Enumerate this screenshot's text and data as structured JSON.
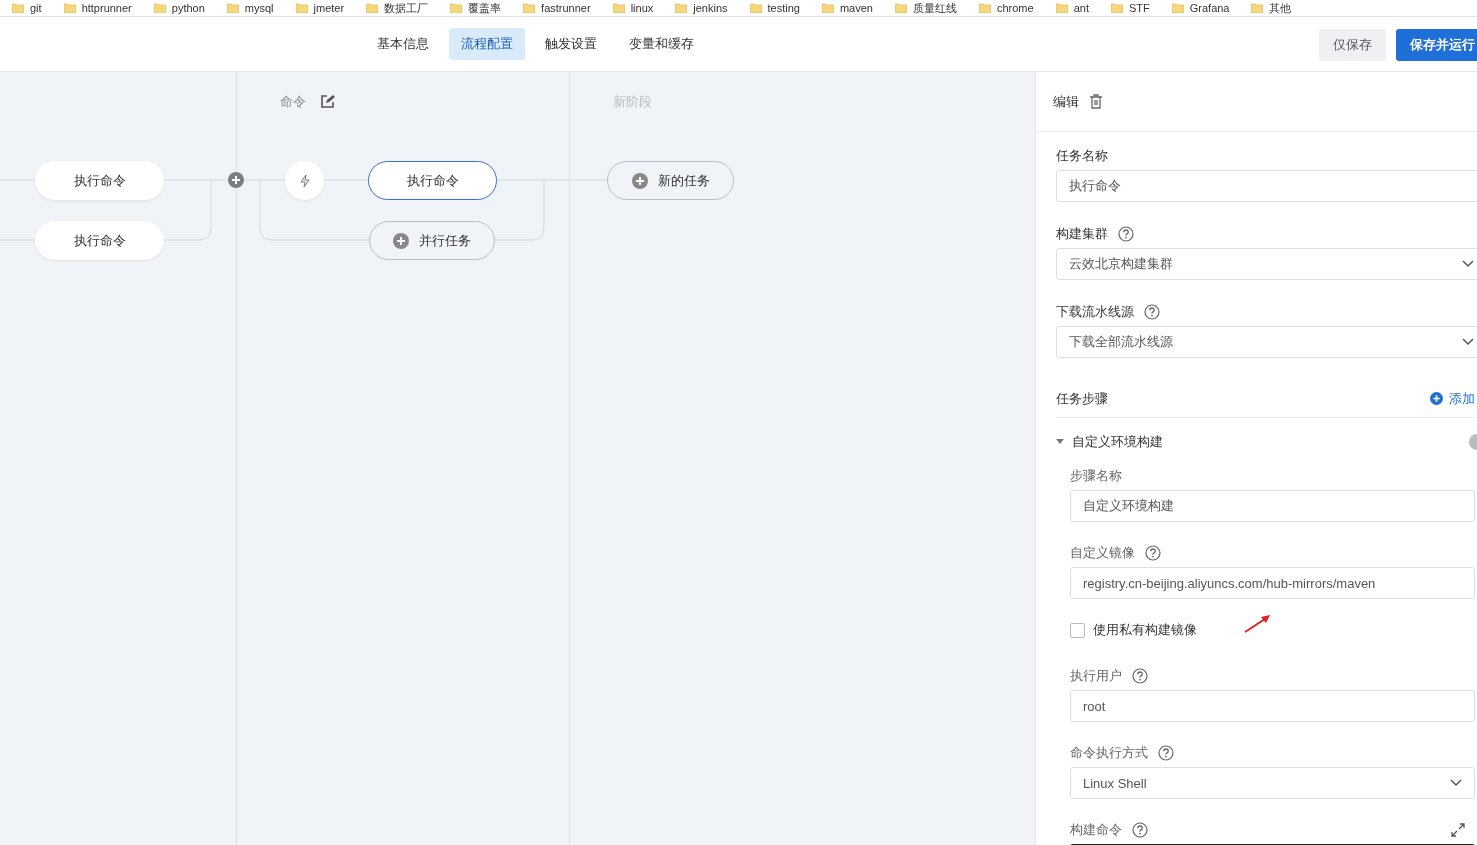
{
  "bookmarks": [
    "git",
    "httprunner",
    "python",
    "mysql",
    "jmeter",
    "数据工厂",
    "覆盖率",
    "fastrunner",
    "linux",
    "jenkins",
    "testing",
    "maven",
    "质量红线",
    "chrome",
    "ant",
    "STF",
    "Grafana",
    "其他"
  ],
  "header": {
    "tabs": [
      {
        "label": "基本信息",
        "selected": false
      },
      {
        "label": "流程配置",
        "selected": true
      },
      {
        "label": "触发设置",
        "selected": false
      },
      {
        "label": "变量和缓存",
        "selected": false
      }
    ],
    "buttons": [
      {
        "label": "仅保存",
        "kind": "secondary"
      },
      {
        "label": "保存并运行",
        "kind": "primary"
      }
    ]
  },
  "canvas": {
    "stages": [
      {
        "tasks": [
          {
            "label": "执行命令",
            "selected": false
          },
          {
            "label": "执行命令",
            "selected": false
          }
        ]
      },
      {
        "title": "命令",
        "muted": false,
        "tasks": [
          {
            "label": "执行命令",
            "selected": true
          }
        ],
        "add_label": "并行任务"
      },
      {
        "title": "新阶段",
        "muted": true,
        "add_label": "新的任务"
      }
    ]
  },
  "panel": {
    "title": "编辑",
    "fields": [
      {
        "kind": "input",
        "label": "任务名称",
        "value": "执行命令"
      },
      {
        "kind": "select",
        "label": "构建集群",
        "value": "云效北京构建集群",
        "help": true
      },
      {
        "kind": "select",
        "label": "下载流水线源",
        "value": "下载全部流水线源",
        "help": true
      }
    ],
    "steps": {
      "label": "任务步骤",
      "add": "添加",
      "step": {
        "title": "自定义环境构建",
        "expanded": true,
        "fields": [
          {
            "kind": "input",
            "label": "步骤名称",
            "value": "自定义环境构建"
          },
          {
            "kind": "input",
            "label": "自定义镜像",
            "value": "registry.cn-beijing.aliyuncs.com/hub-mirrors/maven",
            "help": true
          },
          {
            "kind": "checkbox",
            "label": "使用私有构建镜像",
            "checked": false
          },
          {
            "kind": "input",
            "label": "执行用户",
            "value": "root",
            "help": true
          },
          {
            "kind": "select",
            "label": "命令执行方式",
            "value": "Linux Shell",
            "help": true
          },
          {
            "kind": "code",
            "label": "构建命令",
            "help": true
          }
        ]
      }
    }
  }
}
